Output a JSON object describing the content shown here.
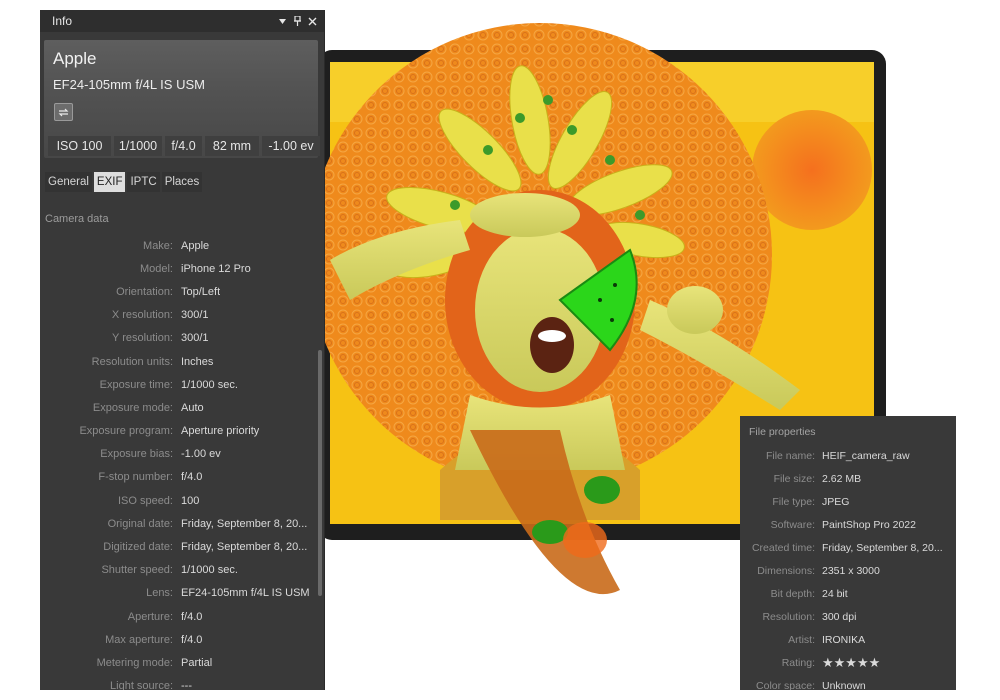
{
  "info_panel": {
    "title": "Info",
    "camera": {
      "make": "Apple",
      "lens": "EF24-105mm f/4L IS USM",
      "stats": [
        "ISO 100",
        "1/1000",
        "f/4.0",
        "82 mm",
        "-1.00 ev"
      ]
    },
    "tabs": [
      "General",
      "EXIF",
      "IPTC",
      "Places"
    ],
    "active_tab": "EXIF",
    "section": "Camera data",
    "rows": [
      {
        "label": "Make:",
        "value": "Apple"
      },
      {
        "label": "Model:",
        "value": "iPhone 12 Pro"
      },
      {
        "label": "Orientation:",
        "value": "Top/Left"
      },
      {
        "label": "X resolution:",
        "value": "300/1"
      },
      {
        "label": "Y resolution:",
        "value": "300/1"
      },
      {
        "label": "Resolution units:",
        "value": "Inches"
      },
      {
        "label": "Exposure time:",
        "value": "1/1000 sec."
      },
      {
        "label": "Exposure mode:",
        "value": "Auto"
      },
      {
        "label": "Exposure program:",
        "value": "Aperture priority"
      },
      {
        "label": "Exposure bias:",
        "value": "-1.00 ev"
      },
      {
        "label": "F-stop number:",
        "value": "f/4.0"
      },
      {
        "label": "ISO speed:",
        "value": "100"
      },
      {
        "label": "Original date:",
        "value": "Friday, September 8, 20..."
      },
      {
        "label": "Digitized date:",
        "value": "Friday, September 8, 20..."
      },
      {
        "label": "Shutter speed:",
        "value": "1/1000 sec."
      },
      {
        "label": "Lens:",
        "value": "EF24-105mm f/4L IS USM"
      },
      {
        "label": "Aperture:",
        "value": "f/4.0"
      },
      {
        "label": "Max aperture:",
        "value": "f/4.0"
      },
      {
        "label": "Metering mode:",
        "value": "Partial"
      },
      {
        "label": "Light source:",
        "value": "---"
      }
    ]
  },
  "file_properties": {
    "title": "File properties",
    "rows": [
      {
        "label": "File name:",
        "value": "HEIF_camera_raw"
      },
      {
        "label": "File size:",
        "value": "2.62 MB"
      },
      {
        "label": "File type:",
        "value": "JPEG"
      },
      {
        "label": "Software:",
        "value": "PaintShop Pro 2022"
      },
      {
        "label": "Created time:",
        "value": "Friday, September 8, 20..."
      },
      {
        "label": "Dimensions:",
        "value": "2351 x 3000"
      },
      {
        "label": "Bit depth:",
        "value": "24 bit"
      },
      {
        "label": "Resolution:",
        "value": "300 dpi"
      },
      {
        "label": "Artist:",
        "value": "IRONIKA"
      },
      {
        "label": "Rating:",
        "value": "★★★★★",
        "rating": 5,
        "max": 5
      },
      {
        "label": "Color space:",
        "value": "Unknown"
      }
    ]
  },
  "colors": {
    "panel_bg": "#393939",
    "title_bar": "#2e2e2e",
    "star": "#f2cc2a",
    "artwork_orange": "#f08a1e",
    "artwork_yellow": "#f7c614"
  },
  "icons": [
    "pin-icon",
    "close-icon",
    "dropdown-icon",
    "swap-icon"
  ]
}
